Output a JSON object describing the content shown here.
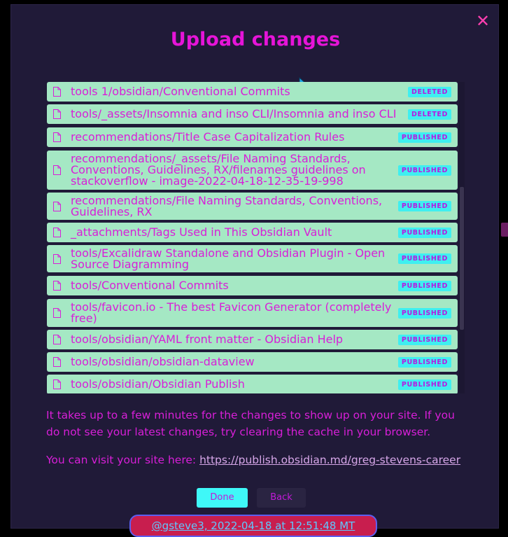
{
  "dialog": {
    "title": "Upload changes",
    "close_icon": "close-icon"
  },
  "items": [
    {
      "path": "tools 1/obsidian/Conventional Commits",
      "status": "DELETED"
    },
    {
      "path": "tools/_assets/Insomnia and inso CLI/Insomnia and inso CLI",
      "status": "DELETED"
    },
    {
      "path": "recommendations/Title Case Capitalization Rules",
      "status": "PUBLISHED"
    },
    {
      "path": "recommendations/_assets/File Naming Standards, Conventions, Guidelines, RX/filenames guidelines on stackoverflow - image-2022-04-18-12-35-19-998",
      "status": "PUBLISHED"
    },
    {
      "path": "recommendations/File Naming Standards, Conventions, Guidelines, RX",
      "status": "PUBLISHED"
    },
    {
      "path": "_attachments/Tags Used in This Obsidian Vault",
      "status": "PUBLISHED"
    },
    {
      "path": "tools/Excalidraw Standalone and Obsidian Plugin - Open Source Diagramming",
      "status": "PUBLISHED"
    },
    {
      "path": "tools/Conventional Commits",
      "status": "PUBLISHED"
    },
    {
      "path": "tools/favicon.io - The best Favicon Generator (completely free)",
      "status": "PUBLISHED"
    },
    {
      "path": "tools/obsidian/YAML front matter - Obsidian Help",
      "status": "PUBLISHED"
    },
    {
      "path": "tools/obsidian/obsidian-dataview",
      "status": "PUBLISHED"
    },
    {
      "path": "tools/obsidian/Obsidian Publish",
      "status": "PUBLISHED"
    }
  ],
  "info_text": "It takes up to a few minutes for the changes to show up on your site. If you do not see your latest changes, try clearing the cache in your browser.",
  "visit": {
    "prefix": "You can visit your site here:",
    "link": "https://publish.obsidian.md/greg-stevens-career"
  },
  "buttons": {
    "done": "Done",
    "back": "Back"
  },
  "footer": {
    "text": "@gsteve3, 2022-04-18 at 12:51:48 MT"
  },
  "colors": {
    "background": "#201a38",
    "accent": "#e614d8",
    "row_bg": "#a5e8c4",
    "badge_bg": "#3feff0",
    "done_bg": "#3ff8f8"
  }
}
